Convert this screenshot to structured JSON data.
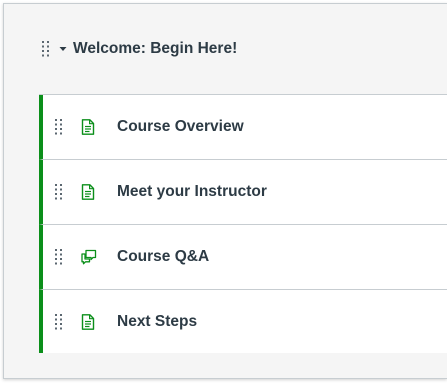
{
  "module": {
    "title": "Welcome: Begin Here!",
    "accent_color": "#0b8f1a",
    "items": [
      {
        "title": "Course Overview",
        "icon": "page-icon"
      },
      {
        "title": "Meet your Instructor",
        "icon": "page-icon"
      },
      {
        "title": "Course Q&A",
        "icon": "discussion-icon"
      },
      {
        "title": "Next Steps",
        "icon": "page-icon"
      }
    ]
  }
}
